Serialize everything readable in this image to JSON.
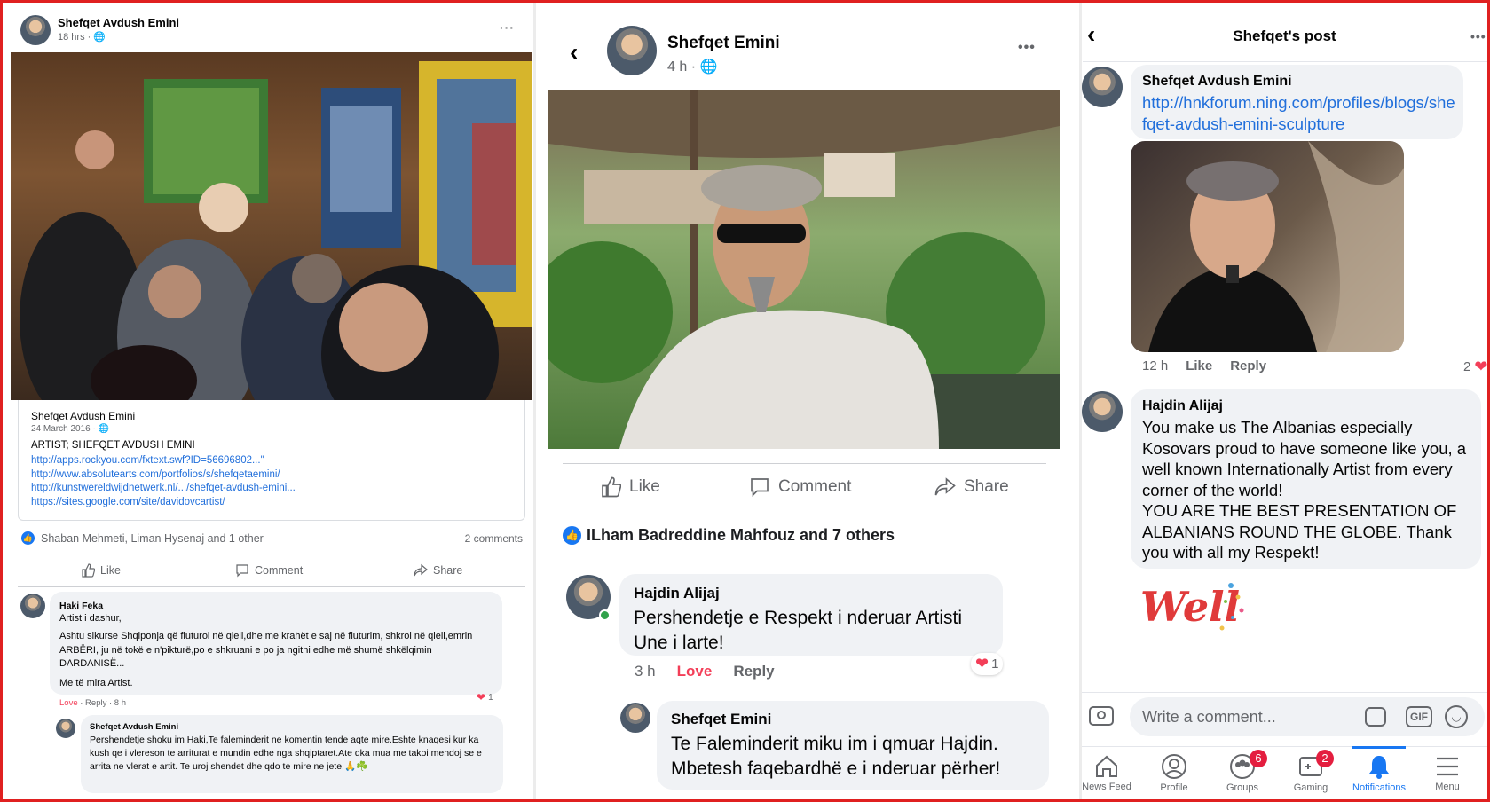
{
  "panel1": {
    "author": "Shefqet Avdush Emini",
    "time": "18 hrs ·",
    "more": "···",
    "shared": {
      "author": "Shefqet Avdush Emini",
      "date": "24 March 2016 ·",
      "text": "ARTIST; SHEFQET AVDUSH EMINI",
      "links": [
        "http://apps.rockyou.com/fxtext.swf?ID=56696802...\"",
        "http://www.absolutearts.com/portfolios/s/shefqetaemini/",
        "http://kunstwereldwijdnetwerk.nl/.../shefqet-avdush-emini...",
        "https://sites.google.com/site/davidovcartist/"
      ]
    },
    "reactions": "Shaban Mehmeti, Liman Hysenaj and 1 other",
    "comments_count": "2 comments",
    "actions": {
      "like": "Like",
      "comment": "Comment",
      "share": "Share"
    },
    "comment1": {
      "author": "Haki Feka",
      "greeting": "Artist i dashur,",
      "body": "Ashtu sikurse Shqiponja që fluturoi në qiell,dhe me krahët e saj në fluturim, shkroi në qiell,emrin ARBËRI, ju në tokë e n'pikturë,po e shkruani e po ja ngitni edhe më shumë shkëlqimin DARDANISË...",
      "sign": "Me të mira Artist.",
      "love": "Love",
      "meta": " · Reply · 8 h",
      "react_count": "1"
    },
    "reply1": {
      "author": "Shefqet Avdush Emini",
      "body": "Pershendetje shoku im Haki,Te faleminderit ne komentin tende aqte mire.Eshte knaqesi kur ka kush qe i vlereson te arriturat e mundin edhe nga shqiptaret.Ate qka mua me takoi mendoj se e arrita ne vlerat e artit. Te uroj shendet dhe qdo te mire ne jete.🙏☘️"
    }
  },
  "panel2": {
    "author": "Shefqet Emini",
    "time": "4 h ·",
    "more": "•••",
    "actions": {
      "like": "Like",
      "comment": "Comment",
      "share": "Share"
    },
    "reactions": "ILham Badreddine Mahfouz and 7 others",
    "comment1": {
      "author": "Hajdin Alijaj",
      "body": "Pershendetje e Respekt i nderuar Artisti Une i larte!",
      "time": "3 h",
      "love": "Love",
      "reply": "Reply",
      "react_count": "1"
    },
    "reply1": {
      "author": "Shefqet Emini",
      "body": "Te Faleminderit  miku im i qmuar Hajdin. Mbetesh faqebardhë e i nderuar përher!"
    }
  },
  "panel3": {
    "title": "Shefqet's post",
    "more": "•••",
    "comment1": {
      "author": "Shefqet Avdush Emini",
      "link": "http://hnkforum.ning.com/profiles/blogs/shefqet-avdush-emini-sculpture",
      "time": "12 h",
      "like": "Like",
      "reply": "Reply",
      "react_count": "2"
    },
    "comment2": {
      "author": "Hajdin Alijaj",
      "body": "You make us The Albanias especially Kosovars proud to have someone like you, a well known Internationally Artist from every corner of the world!\nYOU ARE THE BEST PRESENTATION OF ALBANIANS ROUND THE GLOBE. Thank you with all my Respekt!",
      "sticker": "Well Done"
    },
    "composer": {
      "placeholder": "Write a comment...",
      "gif": "GIF"
    },
    "nav": [
      {
        "label": "News Feed",
        "icon": "home-icon",
        "badge": ""
      },
      {
        "label": "Profile",
        "icon": "profile-icon",
        "badge": ""
      },
      {
        "label": "Groups",
        "icon": "groups-icon",
        "badge": "6"
      },
      {
        "label": "Gaming",
        "icon": "gaming-icon",
        "badge": "2"
      },
      {
        "label": "Notifications",
        "icon": "bell-icon",
        "badge": ""
      },
      {
        "label": "Menu",
        "icon": "menu-icon",
        "badge": ""
      }
    ],
    "colors": {
      "accent": "#1877f2",
      "badge": "#e41e3f",
      "link": "#216fdb"
    }
  }
}
